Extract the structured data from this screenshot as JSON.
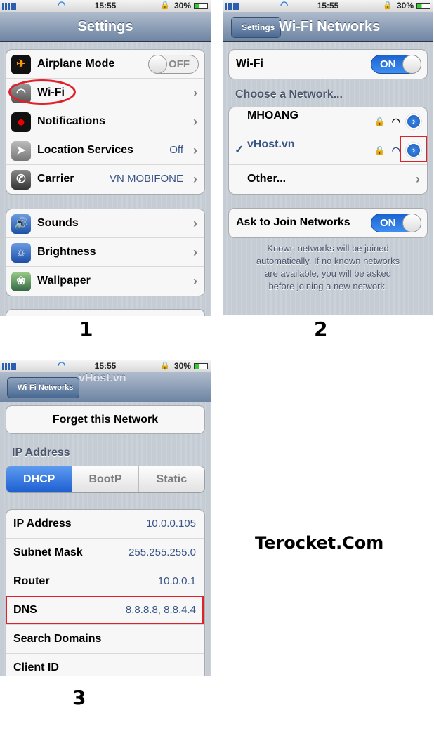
{
  "status": {
    "time": "15:55",
    "battery": "30%"
  },
  "panel1": {
    "title": "Settings",
    "group1": [
      {
        "label": "Airplane Mode",
        "icon": "airplane-icon",
        "toggle": "OFF"
      },
      {
        "label": "Wi-Fi",
        "icon": "wifi-icon"
      },
      {
        "label": "Notifications",
        "icon": "notifications-icon"
      },
      {
        "label": "Location Services",
        "icon": "location-icon",
        "value": "Off"
      },
      {
        "label": "Carrier",
        "icon": "phone-icon",
        "value": "VN MOBIFONE"
      }
    ],
    "group2": [
      {
        "label": "Sounds",
        "icon": "speaker-icon"
      },
      {
        "label": "Brightness",
        "icon": "brightness-icon"
      },
      {
        "label": "Wallpaper",
        "icon": "wallpaper-icon"
      }
    ],
    "step": "1"
  },
  "panel2": {
    "back": "Settings",
    "title": "Wi-Fi Networks",
    "wifi_label": "Wi-Fi",
    "wifi_toggle": "ON",
    "choose_header": "Choose a Network...",
    "networks": [
      {
        "name": "MHOANG"
      },
      {
        "name": "vHost.vn",
        "check": "✓"
      }
    ],
    "other": "Other...",
    "ask_label": "Ask to Join Networks",
    "ask_toggle": "ON",
    "footer": "Known networks will be joined automatically. If no known networks are available, you will be asked before joining a new network.",
    "step": "2"
  },
  "panel3": {
    "back": "Wi-Fi Networks",
    "title": "vHost.vn",
    "forget": "Forget this Network",
    "ip_header": "IP Address",
    "segments": [
      "DHCP",
      "BootP",
      "Static"
    ],
    "selected_segment": "DHCP",
    "rows": [
      {
        "label": "IP Address",
        "value": "10.0.0.105"
      },
      {
        "label": "Subnet Mask",
        "value": "255.255.255.0"
      },
      {
        "label": "Router",
        "value": "10.0.0.1"
      },
      {
        "label": "DNS",
        "value": "8.8.8.8, 8.8.4.4"
      },
      {
        "label": "Search Domains",
        "value": ""
      },
      {
        "label": "Client ID",
        "value": ""
      }
    ],
    "step": "3"
  },
  "watermark": "Terocket.Com",
  "colors": {
    "highlight": "#e0202a",
    "toggle_on": "#1a64d0",
    "value_text": "#385487"
  }
}
